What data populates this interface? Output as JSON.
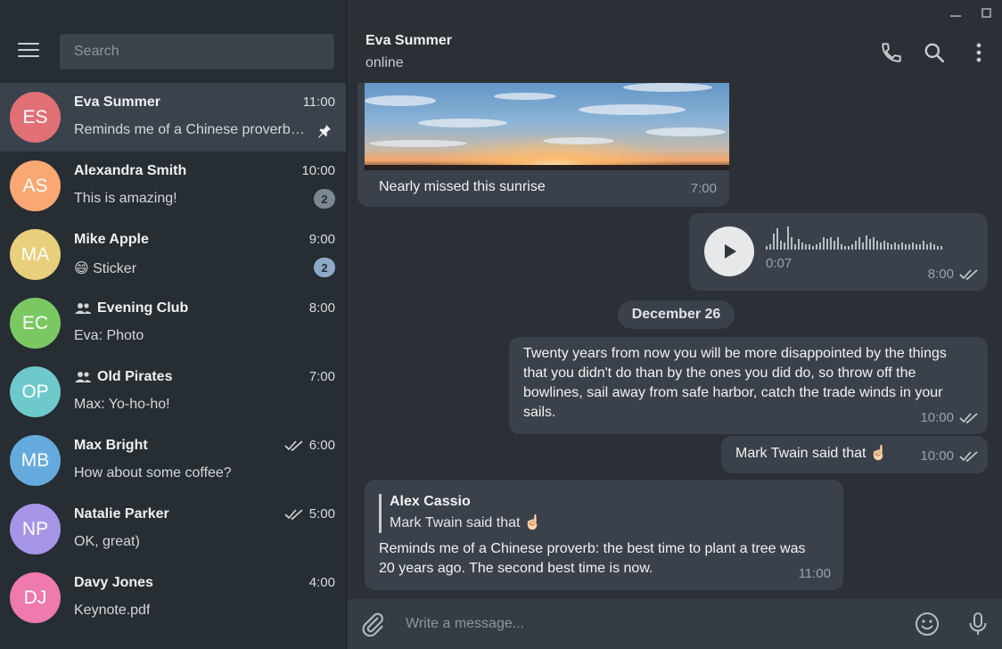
{
  "sidebar": {
    "search_placeholder": "Search",
    "chats": [
      {
        "initials": "ES",
        "name": "Eva Summer",
        "time": "11:00",
        "message": "Reminds me of a Chinese proverb: the best time to plant a tree",
        "color": "#e17076",
        "pinned": true,
        "active": true
      },
      {
        "initials": "AS",
        "name": "Alexandra Smith",
        "time": "10:00",
        "message": "This is amazing!",
        "color": "#faa774",
        "badge": "2"
      },
      {
        "initials": "MA",
        "name": "Mike Apple",
        "time": "9:00",
        "message": "😄 Sticker",
        "color": "#e8cf7b",
        "badge": "2"
      },
      {
        "initials": "EC",
        "name": "Evening Club",
        "time": "8:00",
        "message": "Eva: Photo",
        "color": "#7bc862",
        "group": true
      },
      {
        "initials": "OP",
        "name": "Old Pirates",
        "time": "7:00",
        "message": "Max: Yo-ho-ho!",
        "color": "#6ec9cb",
        "group": true
      },
      {
        "initials": "MB",
        "name": "Max Bright",
        "time": "6:00",
        "message": "How about some coffee?",
        "color": "#65aadd",
        "read": true
      },
      {
        "initials": "NP",
        "name": "Natalie Parker",
        "time": "5:00",
        "message": "OK, great)",
        "color": "#a695e7",
        "read": true
      },
      {
        "initials": "DJ",
        "name": "Davy Jones",
        "time": "4:00",
        "message": "Keynote.pdf",
        "color": "#ee7aae"
      }
    ]
  },
  "header": {
    "name": "Eva Summer",
    "status": "online"
  },
  "messages": {
    "photo_caption": "Nearly missed this sunrise",
    "photo_time": "7:00",
    "voice_duration": "0:07",
    "voice_time": "8:00",
    "date_separator": "December 26",
    "quote_text": "Twenty years from now you will be more disappointed by the things that you didn't do than by the ones you did do, so throw off the bowlines, sail away from safe harbor, catch the trade winds in your sails.",
    "quote_time": "10:00",
    "short_text": "Mark Twain said that ☝🏻",
    "short_time": "10:00",
    "reply_author": "Alex Cassio",
    "reply_quote": "Mark Twain said that ☝🏻",
    "reply_text": "Reminds me of a Chinese proverb: the best time to plant a tree was 20 years ago. The second best time is now.",
    "reply_time": "11:00"
  },
  "composer": {
    "placeholder": "Write a message..."
  },
  "colors": {
    "sidebar_bg": "#262d33",
    "main_bg": "#2b3036",
    "bubble_bg": "#3a414a",
    "active_chat_bg": "#3a424b"
  }
}
